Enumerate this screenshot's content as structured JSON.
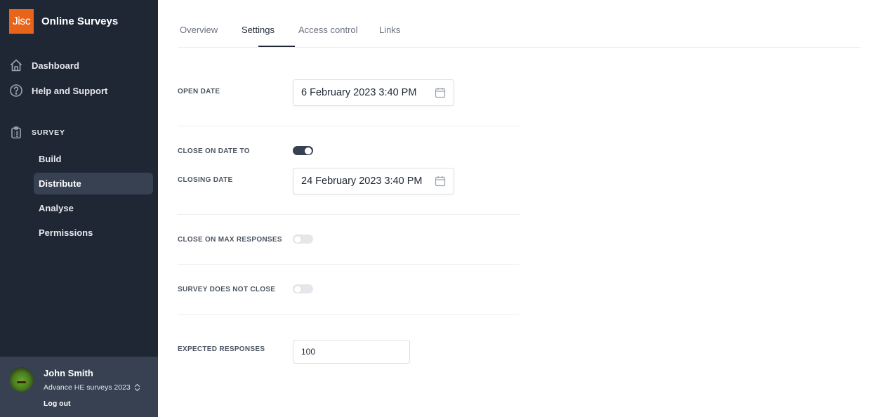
{
  "brand": {
    "logo_text": "Jisc",
    "app_name": "Online Surveys",
    "accent_color": "#e8641b"
  },
  "sidebar": {
    "nav": [
      {
        "label": "Dashboard",
        "icon": "home-icon"
      },
      {
        "label": "Help and Support",
        "icon": "help-circle-icon"
      }
    ],
    "section": {
      "label": "SURVEY",
      "icon": "clipboard-icon"
    },
    "sub_items": [
      {
        "label": "Build",
        "active": false
      },
      {
        "label": "Distribute",
        "active": true
      },
      {
        "label": "Analyse",
        "active": false
      },
      {
        "label": "Permissions",
        "active": false
      }
    ],
    "user": {
      "name": "John Smith",
      "organisation": "Advance HE surveys 2023",
      "logout_label": "Log out"
    }
  },
  "tabs": [
    {
      "label": "Overview",
      "active": false
    },
    {
      "label": "Settings",
      "active": true
    },
    {
      "label": "Access control",
      "active": false
    },
    {
      "label": "Links",
      "active": false
    }
  ],
  "settings": {
    "open_date": {
      "label": "OPEN DATE",
      "value": "6 February 2023 3:40 PM"
    },
    "close_on_date": {
      "label": "CLOSE ON DATE TO",
      "enabled": true
    },
    "closing_date": {
      "label": "CLOSING DATE",
      "value": "24 February 2023 3:40 PM"
    },
    "close_on_max": {
      "label": "CLOSE ON MAX RESPONSES",
      "enabled": false
    },
    "does_not_close": {
      "label": "SURVEY DOES NOT CLOSE",
      "enabled": false
    },
    "expected_responses": {
      "label": "EXPECTED RESPONSES",
      "value": "100"
    }
  }
}
